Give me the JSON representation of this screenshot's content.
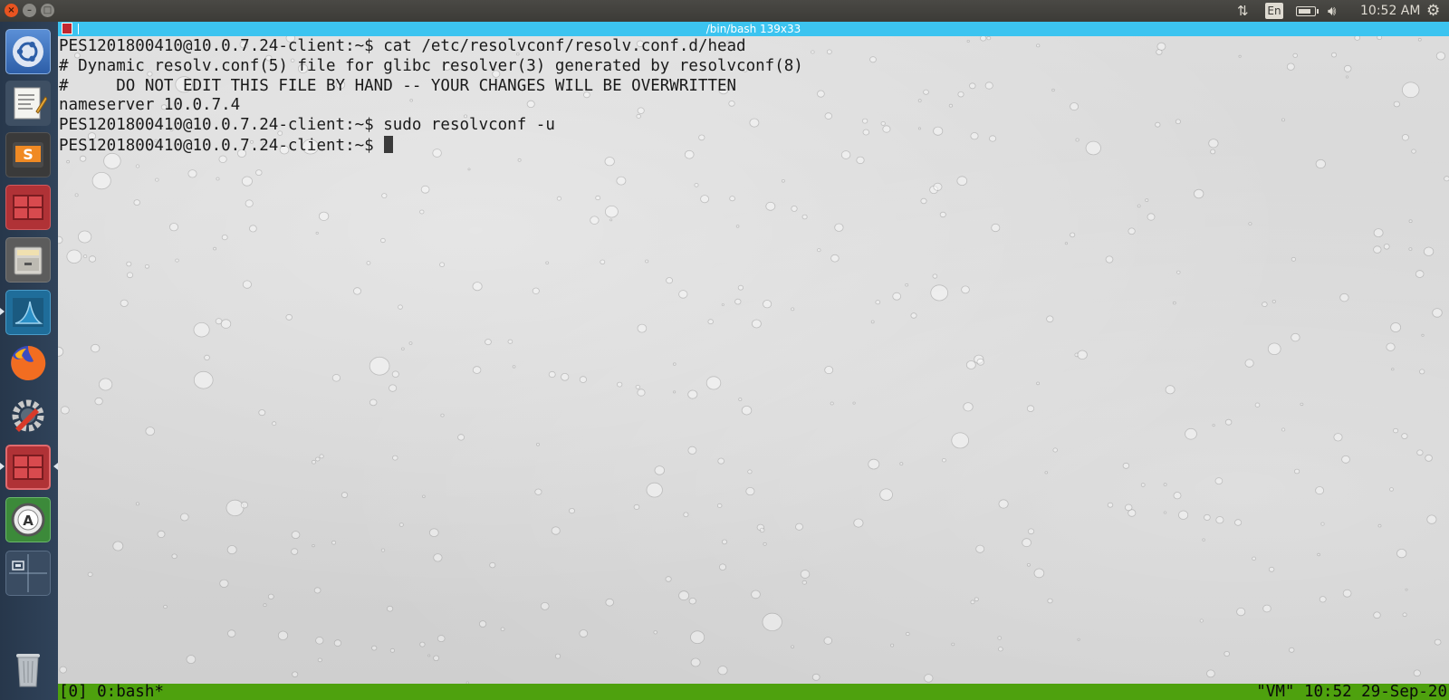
{
  "window_buttons": {
    "close": "×",
    "minimize": "–",
    "maximize": "□"
  },
  "top_panel": {
    "language": "En",
    "clock": "10:52 AM",
    "icons": [
      "network-icon",
      "keyboard-language-indicator",
      "battery-icon",
      "volume-icon",
      "settings-gear-icon"
    ]
  },
  "launcher": {
    "items": [
      "dash-home",
      "text-editor",
      "sublime-text",
      "terminal",
      "file-manager",
      "wireshark",
      "firefox",
      "system-settings",
      "terminal-active",
      "software-updater",
      "workspace-switcher",
      "trash"
    ]
  },
  "terminal": {
    "title": "/bin/bash 139x33",
    "lines": [
      "PES1201800410@10.0.7.24-client:~$ cat /etc/resolvconf/resolv.conf.d/head",
      "# Dynamic resolv.conf(5) file for glibc resolver(3) generated by resolvconf(8)",
      "#     DO NOT EDIT THIS FILE BY HAND -- YOUR CHANGES WILL BE OVERWRITTEN",
      "nameserver 10.0.7.4",
      "PES1201800410@10.0.7.24-client:~$ sudo resolvconf -u"
    ],
    "prompt": "PES1201800410@10.0.7.24-client:~$ "
  },
  "tmux": {
    "left": "[0] 0:bash*",
    "right": "\"VM\" 10:52 29-Sep-20"
  },
  "colors": {
    "accent": "#3cc4f0",
    "tmux_bar": "#4ea10e",
    "launcher": "#2c3e54",
    "ubuntu_orange": "#e95420"
  }
}
